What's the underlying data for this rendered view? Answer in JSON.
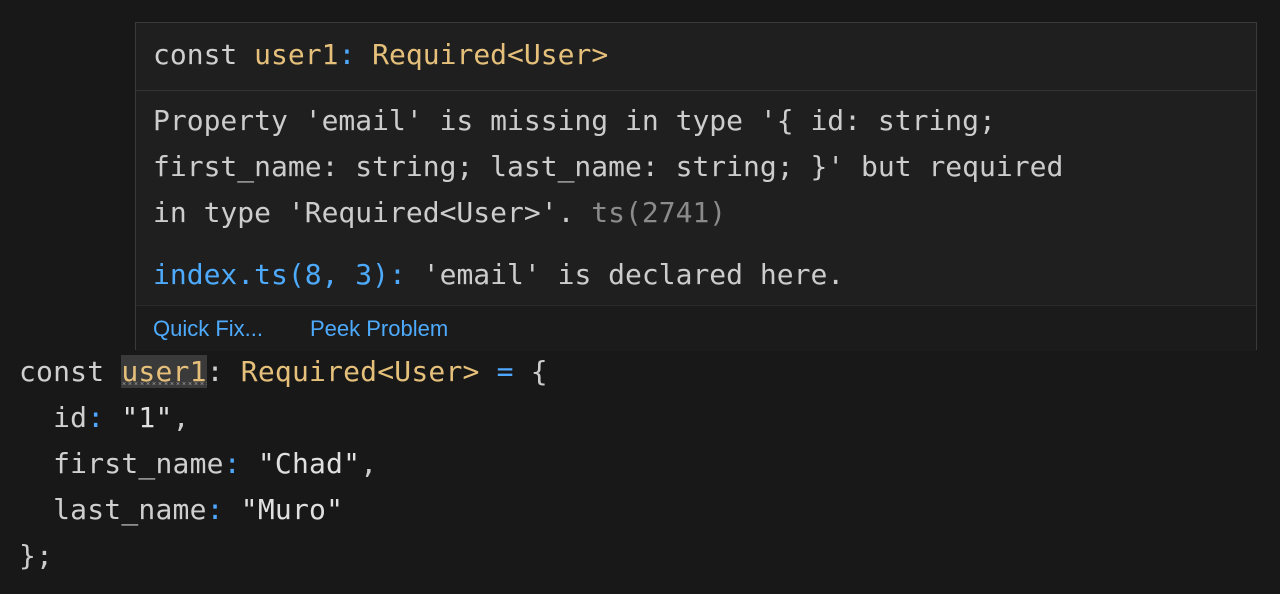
{
  "hover": {
    "signature": {
      "keyword": "const",
      "name": "user1",
      "colon": ":",
      "type": "Required<User>"
    },
    "message": {
      "line1": "Property 'email' is missing in type '{ id: string;",
      "line2": "first_name: string; last_name: string; }' but required",
      "line3": "in type 'Required<User>'.",
      "code": "ts(2741)"
    },
    "related": {
      "location": "index.ts(8, 3):",
      "text": " 'email' is declared here."
    },
    "actions": {
      "quick_fix": "Quick Fix...",
      "peek_problem": "Peek Problem"
    }
  },
  "code": {
    "line1": {
      "keyword": "const",
      "name": "user1",
      "colon": ":",
      "type": "Required<User>",
      "equals": "=",
      "brace": "{"
    },
    "line2": {
      "prop": "id",
      "colon": ":",
      "value": "\"1\"",
      "comma": ","
    },
    "line3": {
      "prop": "first_name",
      "colon": ":",
      "value": "\"Chad\"",
      "comma": ","
    },
    "line4": {
      "prop": "last_name",
      "colon": ":",
      "value": "\"Muro\""
    },
    "line5": {
      "text": "};"
    }
  },
  "colors": {
    "background": "#181818",
    "hover_background": "#1f1f1f",
    "link": "#4daafc",
    "type": "#e5c07b"
  }
}
